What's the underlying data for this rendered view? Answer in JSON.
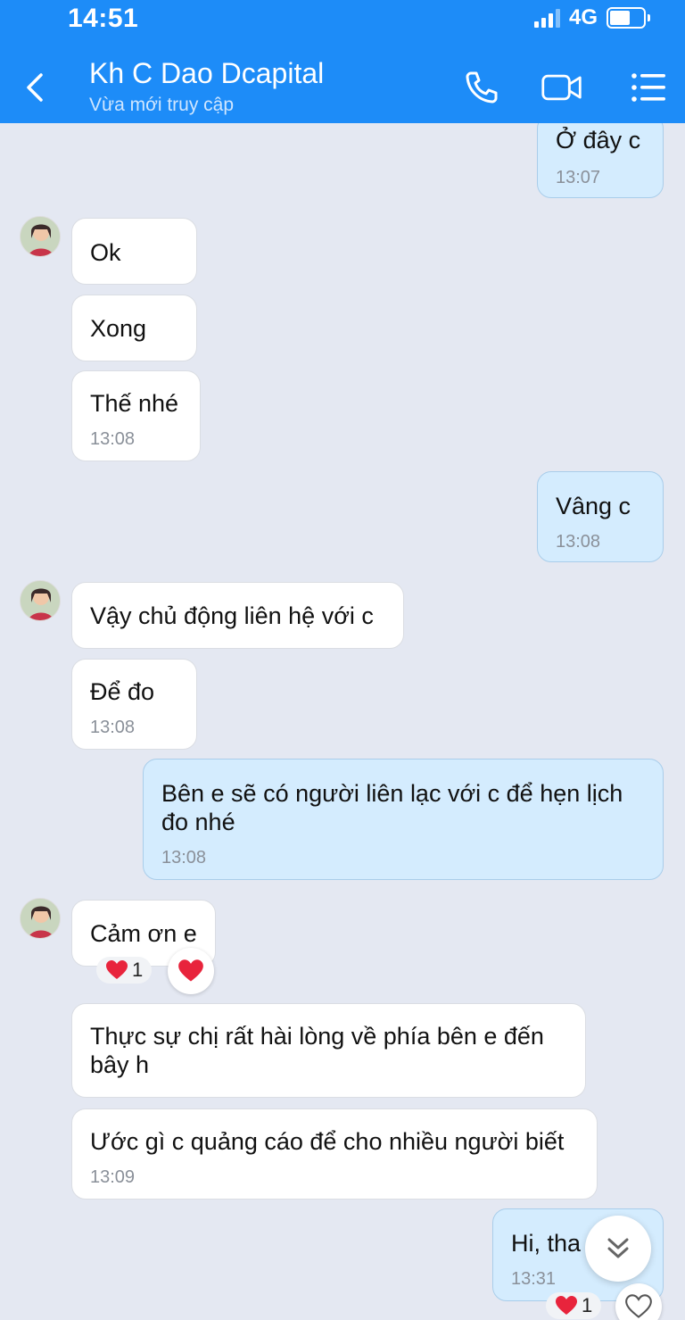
{
  "status_bar": {
    "time": "14:51",
    "network": "4G",
    "battery_level": 0.6
  },
  "header": {
    "contact_name": "Kh C Dao Dcapital",
    "contact_status": "Vừa mới truy cập"
  },
  "icons": [
    "back-icon",
    "phone-icon",
    "video-call-icon",
    "menu-list-icon",
    "heart-icon",
    "chevron-double-down-icon"
  ],
  "accent_color": "#1d8cf8",
  "messages": [
    {
      "from": "me",
      "text": "Ở đây c",
      "time": "13:07"
    },
    {
      "from": "contact",
      "text": "Ok"
    },
    {
      "from": "contact",
      "text": "Xong"
    },
    {
      "from": "contact",
      "text": "Thế nhé",
      "time": "13:08"
    },
    {
      "from": "me",
      "text": "Vâng c",
      "time": "13:08"
    },
    {
      "from": "contact",
      "text": "Vậy chủ động liên hệ với c"
    },
    {
      "from": "contact",
      "text": "Để đo",
      "time": "13:08"
    },
    {
      "from": "me",
      "text_lines": [
        "Bên e sẽ có người liên lạc với c để hẹn lịch",
        "đo nhé"
      ],
      "time": "13:08"
    },
    {
      "from": "contact",
      "text": "Cảm ơn e",
      "reaction_count": "1"
    },
    {
      "from": "contact",
      "text_lines": [
        "Thực sự chị rất hài lòng về phía bên e đến",
        "bây h"
      ]
    },
    {
      "from": "contact",
      "text": "Ước gì c quảng cáo để cho nhiều người biết",
      "time": "13:09"
    },
    {
      "from": "me",
      "text": "Hi, tha",
      "time": "13:31",
      "reaction_count": "1"
    }
  ]
}
